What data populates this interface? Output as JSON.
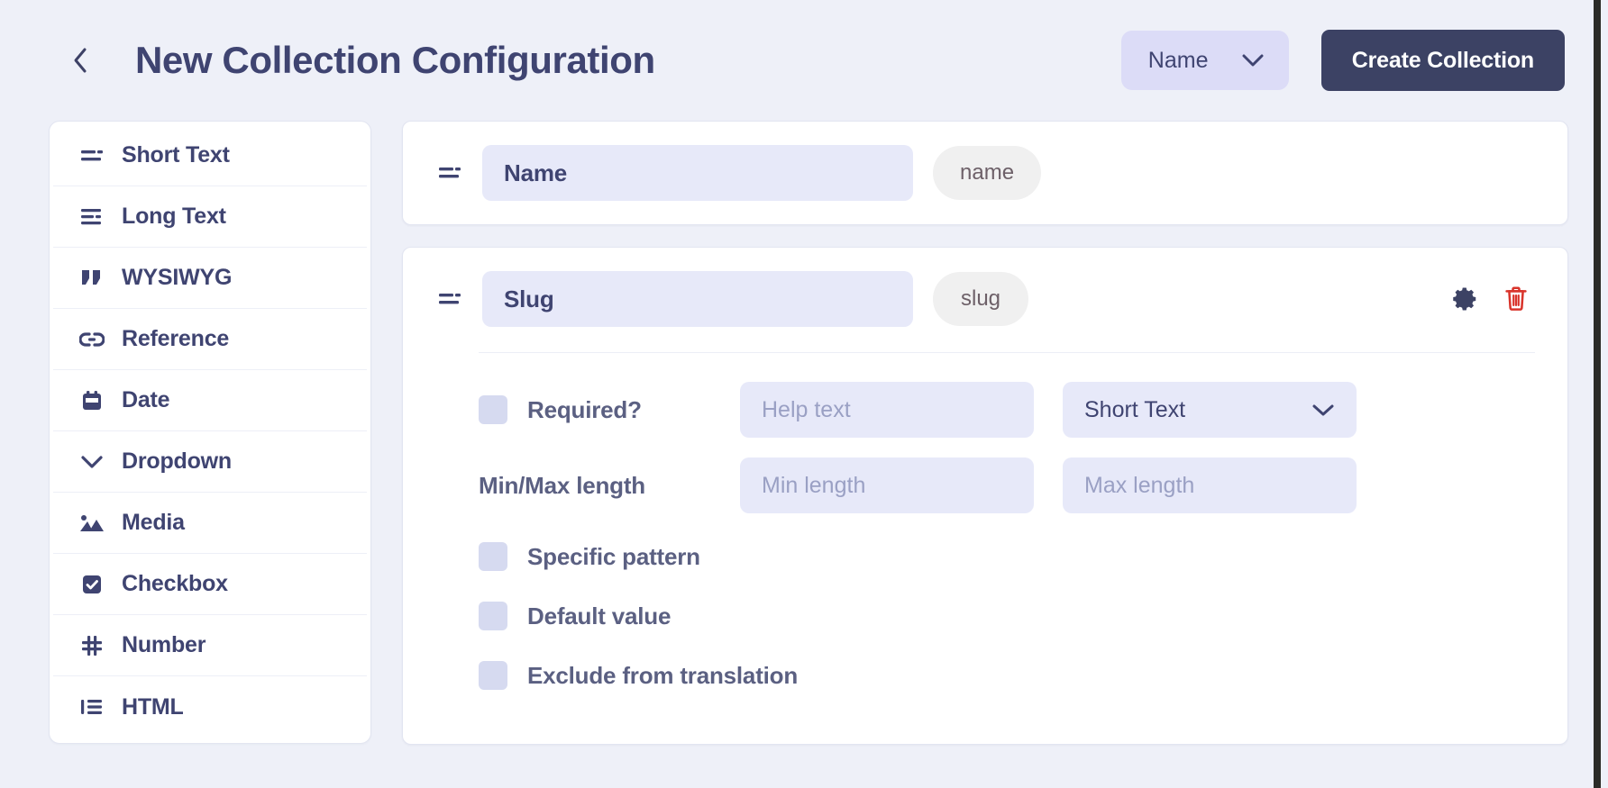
{
  "header": {
    "back_icon": "chevron-left-icon",
    "title": "New Collection Configuration",
    "name_select": {
      "value": "Name",
      "chevron_icon": "chevron-down-icon"
    },
    "create_button": "Create Collection"
  },
  "sidebar": {
    "items": [
      {
        "label": "Short Text",
        "icon": "short-text-icon"
      },
      {
        "label": "Long Text",
        "icon": "long-text-icon"
      },
      {
        "label": "WYSIWYG",
        "icon": "quote-icon"
      },
      {
        "label": "Reference",
        "icon": "link-icon"
      },
      {
        "label": "Date",
        "icon": "calendar-icon"
      },
      {
        "label": "Dropdown",
        "icon": "chevron-down-icon"
      },
      {
        "label": "Media",
        "icon": "image-icon"
      },
      {
        "label": "Checkbox",
        "icon": "checkbox-checked-icon"
      },
      {
        "label": "Number",
        "icon": "hash-icon"
      },
      {
        "label": "HTML",
        "icon": "list-icon"
      }
    ]
  },
  "fields": [
    {
      "icon": "short-text-icon",
      "name_value": "Name",
      "name_placeholder": "Name",
      "slug": "name",
      "expanded": false
    },
    {
      "icon": "short-text-icon",
      "name_value": "Slug",
      "name_placeholder": "Name",
      "slug": "slug",
      "expanded": true,
      "actions": {
        "settings_icon": "gear-icon",
        "delete_icon": "trash-icon"
      },
      "settings": {
        "required_label": "Required?",
        "help_text_placeholder": "Help text",
        "type_value": "Short Text",
        "type_chevron": "chevron-down-icon",
        "minmax_label": "Min/Max length",
        "min_placeholder": "Min length",
        "max_placeholder": "Max length",
        "specific_pattern_label": "Specific pattern",
        "default_value_label": "Default value",
        "exclude_translation_label": "Exclude from translation"
      }
    }
  ],
  "colors": {
    "page_background": "#eef0f8",
    "accent_dark": "#3c4264",
    "text_primary": "#3f4471",
    "input_background": "#e7e9f9",
    "select_background": "#dcdcf7",
    "pill_background": "#f0f0f0",
    "danger": "#d9342b",
    "checkbox": "#d6daf0"
  }
}
